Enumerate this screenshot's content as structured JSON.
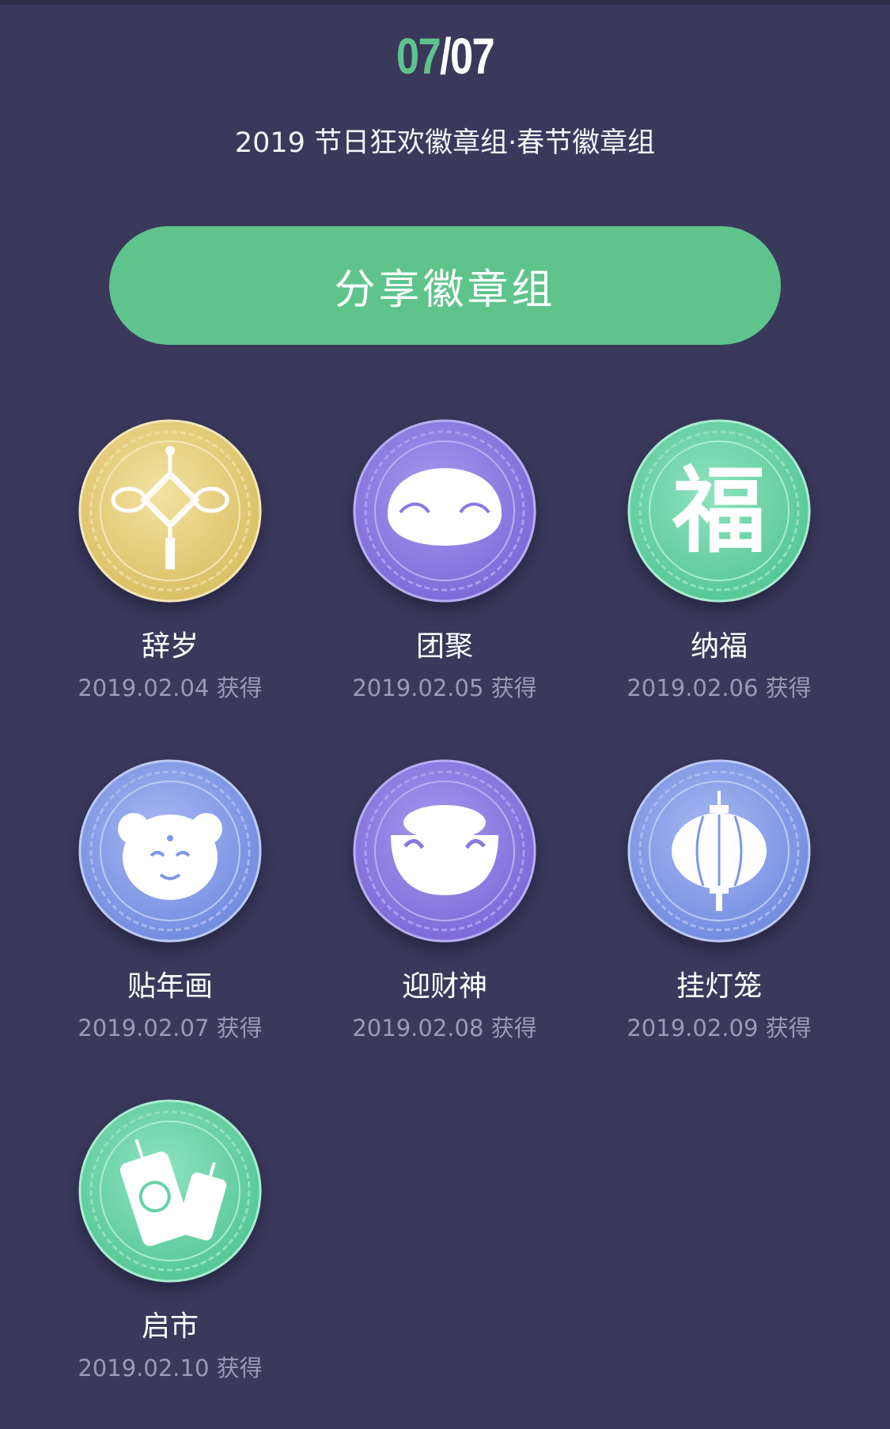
{
  "counter": {
    "current": "07",
    "separator": "/",
    "total": "07"
  },
  "subtitle": "2019 节日狂欢徽章组·春节徽章组",
  "share_button": "分享徽章组",
  "colors": {
    "background": "#3a395c",
    "accent_green": "#5ec48c",
    "date_gray": "#9b9ab6",
    "coin_gold": "#e6d07c",
    "coin_purple": "#8a78e0",
    "coin_teal": "#68d2a6",
    "coin_blue": "#7f97e6"
  },
  "badges": [
    {
      "name": "辞岁",
      "date": "2019.02.04 获得",
      "icon": "chinese-knot-icon",
      "color": "gold"
    },
    {
      "name": "团聚",
      "date": "2019.02.05 获得",
      "icon": "dumpling-icon",
      "color": "purple"
    },
    {
      "name": "纳福",
      "date": "2019.02.06 获得",
      "icon": "fu-character-icon",
      "color": "teal",
      "glyph": "福"
    },
    {
      "name": "贴年画",
      "date": "2019.02.07 获得",
      "icon": "new-year-doll-icon",
      "color": "blue"
    },
    {
      "name": "迎财神",
      "date": "2019.02.08 获得",
      "icon": "gold-ingot-icon",
      "color": "purple"
    },
    {
      "name": "挂灯笼",
      "date": "2019.02.09 获得",
      "icon": "lantern-icon",
      "color": "blue"
    },
    {
      "name": "启市",
      "date": "2019.02.10 获得",
      "icon": "firecracker-icon",
      "color": "teal"
    }
  ]
}
